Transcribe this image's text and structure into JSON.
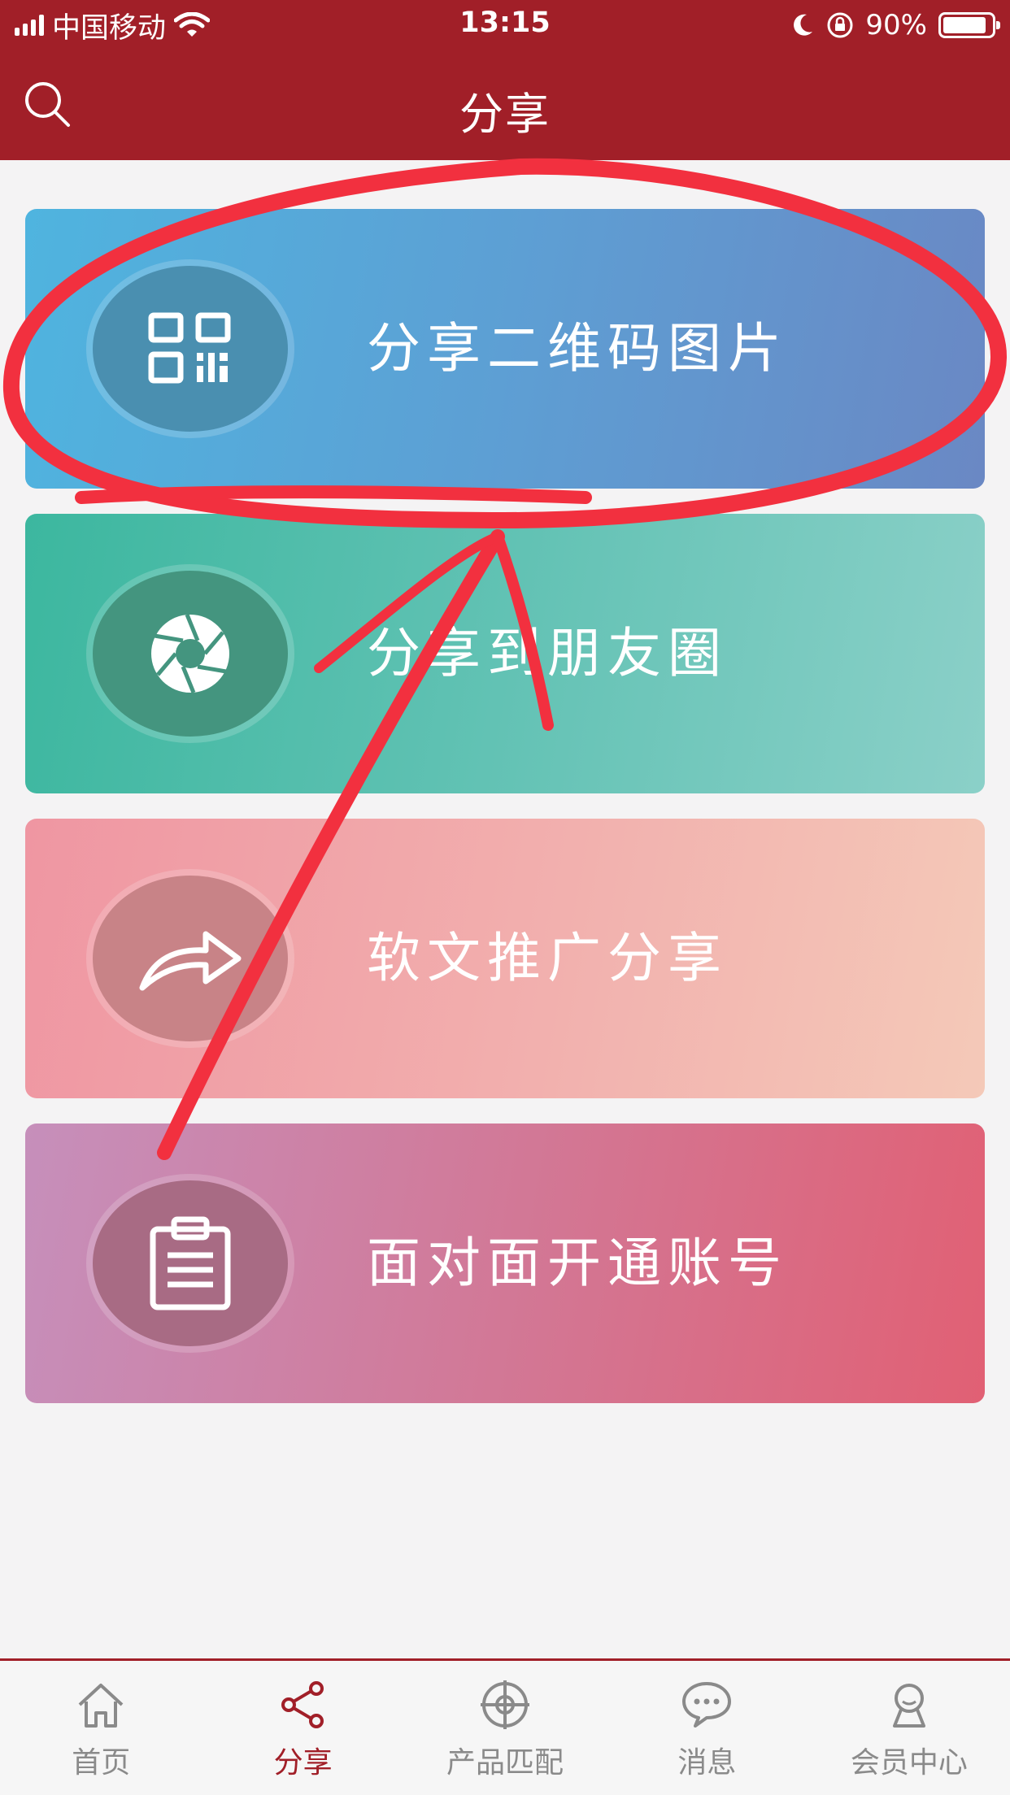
{
  "status_bar": {
    "carrier": "中国移动",
    "time": "13:15",
    "battery": "90%",
    "battery_level": 0.9
  },
  "nav": {
    "title": "分享"
  },
  "cards": [
    {
      "label": "分享二维码图片",
      "icon": "qr-code-icon"
    },
    {
      "label": "分享到朋友圈",
      "icon": "camera-aperture-icon"
    },
    {
      "label": "软文推广分享",
      "icon": "share-arrow-icon"
    },
    {
      "label": "面对面开通账号",
      "icon": "clipboard-icon"
    }
  ],
  "tabbar": {
    "items": [
      {
        "label": "首页",
        "icon": "home-icon",
        "active": false
      },
      {
        "label": "分享",
        "icon": "share-icon",
        "active": true
      },
      {
        "label": "产品匹配",
        "icon": "target-icon",
        "active": false
      },
      {
        "label": "消息",
        "icon": "message-icon",
        "active": false
      },
      {
        "label": "会员中心",
        "icon": "member-icon",
        "active": false
      }
    ]
  },
  "colors": {
    "header": "#a11f28",
    "annotation": "#f2303f",
    "tab_active": "#a11f28",
    "tab_inactive": "#8a8a8a"
  }
}
